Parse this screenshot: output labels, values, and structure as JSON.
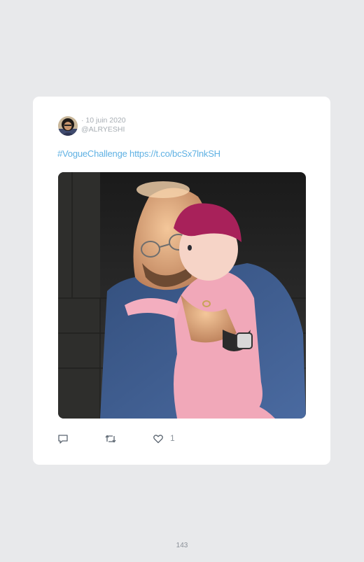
{
  "tweet": {
    "date": "10 juin 2020",
    "handle": "@ALRYESHI",
    "text": "#VogueChallenge https://t.co/bcSx7lnkSH",
    "like_count": "1",
    "icons": {
      "reply": "speech-bubble-icon",
      "retweet": "retweet-icon",
      "like": "heart-icon"
    }
  },
  "colors": {
    "page_background": "#e8e9eb",
    "card_background": "#ffffff",
    "link": "#5fb1e3",
    "meta_text": "#a7adb3"
  },
  "page": {
    "number": "143"
  }
}
